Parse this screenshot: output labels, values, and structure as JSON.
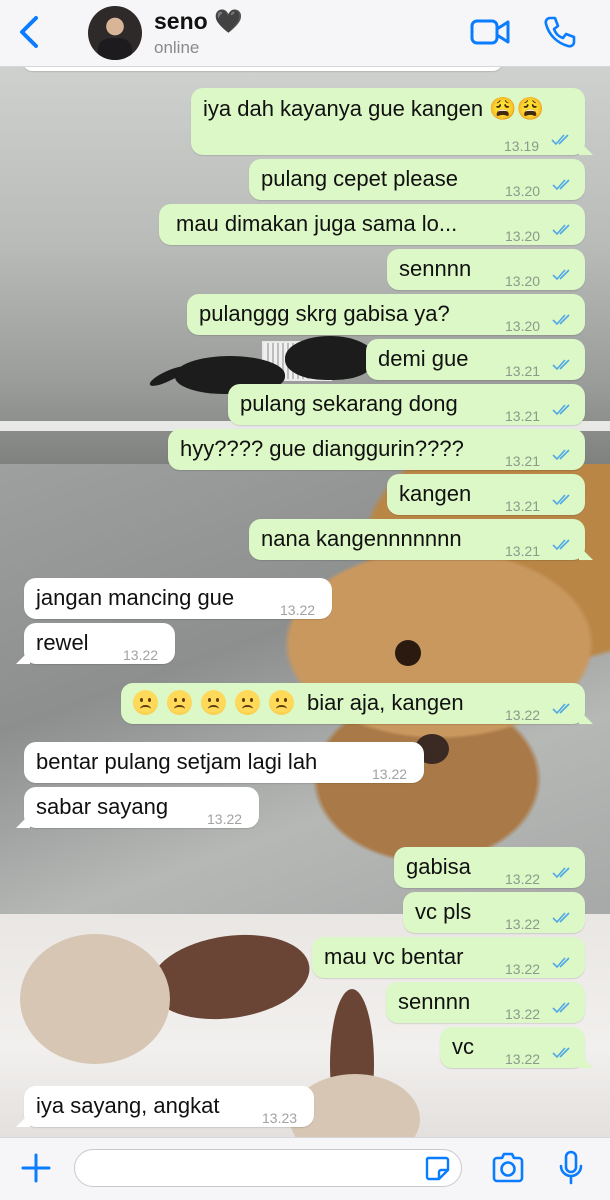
{
  "contact": {
    "name": "seno 🖤",
    "status": "online"
  },
  "header_icons": [
    "back-chevron-icon",
    "video-call-icon",
    "phone-call-icon"
  ],
  "input_bar": {
    "placeholder": "",
    "icons": [
      "plus-icon",
      "sticker-icon",
      "camera-icon",
      "microphone-icon"
    ]
  },
  "colors": {
    "accent": "#0a7cff",
    "outgoing_bubble": "#dcf8c6",
    "incoming_bubble": "#ffffff",
    "read_ticks": "#4fa8e8"
  },
  "messages": [
    {
      "dir": "out",
      "text": "iya dah kayanya gue kangen 😩😩",
      "time": "13.19",
      "read": true
    },
    {
      "dir": "out",
      "text": "pulang cepet please",
      "time": "13.20",
      "read": true
    },
    {
      "dir": "out",
      "text": "mau dimakan juga sama lo...",
      "time": "13.20",
      "read": true
    },
    {
      "dir": "out",
      "text": "sennnn",
      "time": "13.20",
      "read": true
    },
    {
      "dir": "out",
      "text": "pulanggg skrg gabisa ya?",
      "time": "13.20",
      "read": true
    },
    {
      "dir": "out",
      "text": "demi gue",
      "time": "13.21",
      "read": true
    },
    {
      "dir": "out",
      "text": "pulang sekarang dong",
      "time": "13.21",
      "read": true
    },
    {
      "dir": "out",
      "text": "hyy???? gue dianggurin????",
      "time": "13.21",
      "read": true
    },
    {
      "dir": "out",
      "text": "kangen",
      "time": "13.21",
      "read": true
    },
    {
      "dir": "out",
      "text": "nana kangennnnnnn",
      "time": "13.21",
      "read": true
    },
    {
      "dir": "in",
      "text": "jangan mancing gue",
      "time": "13.22"
    },
    {
      "dir": "in",
      "text": "rewel",
      "time": "13.22"
    },
    {
      "dir": "out",
      "text": "biar aja, kangen",
      "emoji_prefix": "☹️☹️☹️☹️☹️",
      "time": "13.22",
      "read": true
    },
    {
      "dir": "in",
      "text": "bentar pulang setjam lagi lah",
      "time": "13.22"
    },
    {
      "dir": "in",
      "text": "sabar sayang",
      "time": "13.22"
    },
    {
      "dir": "out",
      "text": "gabisa",
      "time": "13.22",
      "read": true
    },
    {
      "dir": "out",
      "text": "vc pls",
      "time": "13.22",
      "read": true
    },
    {
      "dir": "out",
      "text": "mau vc bentar",
      "time": "13.22",
      "read": true
    },
    {
      "dir": "out",
      "text": "sennnn",
      "time": "13.22",
      "read": true
    },
    {
      "dir": "out",
      "text": "vc",
      "time": "13.22",
      "read": true
    },
    {
      "dir": "in",
      "text": "iya sayang, angkat",
      "time": "13.23"
    }
  ]
}
